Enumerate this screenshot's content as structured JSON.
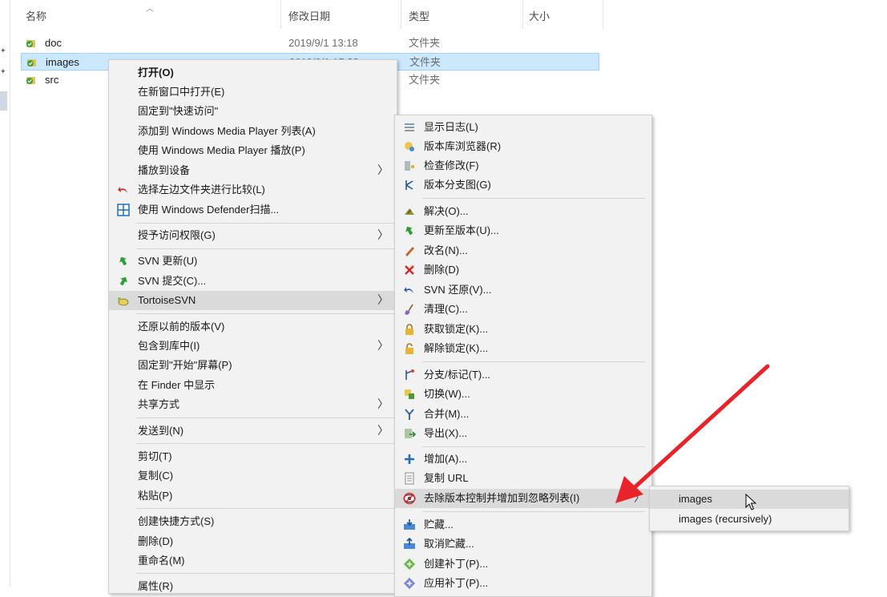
{
  "columns": {
    "name": "名称",
    "modified": "修改日期",
    "type": "类型",
    "size": "大小"
  },
  "files": [
    {
      "name": "doc",
      "date": "2019/9/1 13:18",
      "type": "文件夹"
    },
    {
      "name": "images",
      "date": "2019/9/1 15:33",
      "type": "文件夹"
    },
    {
      "name": "src",
      "date": "",
      "type": "文件夹"
    }
  ],
  "context_menu": {
    "items": [
      "打开(O)",
      "在新窗口中打开(E)",
      "固定到\"快速访问\"",
      "添加到 Windows Media Player 列表(A)",
      "使用 Windows Media Player 播放(P)",
      "播放到设备",
      "选择左边文件夹进行比较(L)",
      "使用 Windows Defender扫描...",
      "授予访问权限(G)",
      "SVN 更新(U)",
      "SVN 提交(C)...",
      "TortoiseSVN",
      "还原以前的版本(V)",
      "包含到库中(I)",
      "固定到\"开始\"屏幕(P)",
      "在 Finder 中显示",
      "共享方式",
      "发送到(N)",
      "剪切(T)",
      "复制(C)",
      "粘贴(P)",
      "创建快捷方式(S)",
      "删除(D)",
      "重命名(M)",
      "属性(R)"
    ]
  },
  "svn_menu": {
    "items": [
      "显示日志(L)",
      "版本库浏览器(R)",
      "检查修改(F)",
      "版本分支图(G)",
      "解决(O)...",
      "更新至版本(U)...",
      "改名(N)...",
      "删除(D)",
      "SVN 还原(V)...",
      "清理(C)...",
      "获取锁定(K)...",
      "解除锁定(K)...",
      "分支/标记(T)...",
      "切换(W)...",
      "合并(M)...",
      "导出(X)...",
      "增加(A)...",
      "复制 URL",
      "去除版本控制并增加到忽略列表(I)",
      "贮藏...",
      "取消贮藏...",
      "创建补丁(P)...",
      "应用补丁(P)..."
    ]
  },
  "ignore_submenu": {
    "items": [
      "images",
      "images (recursively)"
    ]
  },
  "colors": {
    "selection": "#cce8ff",
    "menu_bg": "#f2f2f2",
    "menu_highlight": "#dadada",
    "annotation_arrow": "#e8232a"
  }
}
